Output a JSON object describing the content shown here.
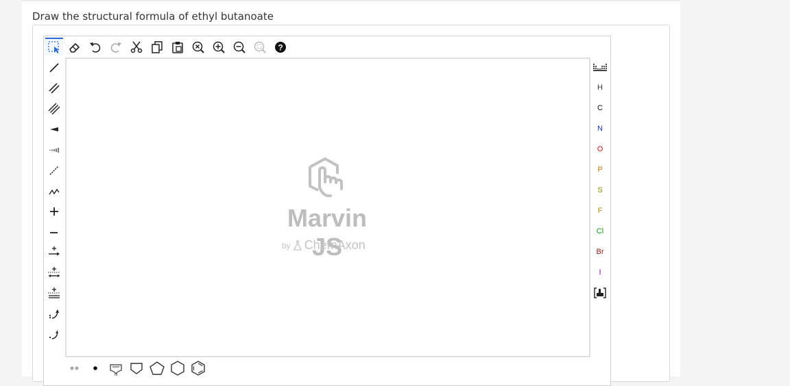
{
  "question": {
    "text": "Draw the structural formula of ethyl butanoate"
  },
  "editor": {
    "logo": {
      "title": "Marvin JS",
      "by": "by",
      "company": "ChemAxon"
    },
    "elements": [
      {
        "symbol": "H",
        "color": "#333333"
      },
      {
        "symbol": "C",
        "color": "#111111"
      },
      {
        "symbol": "N",
        "color": "#2233cc"
      },
      {
        "symbol": "O",
        "color": "#dd1111"
      },
      {
        "symbol": "P",
        "color": "#c77700"
      },
      {
        "symbol": "S",
        "color": "#8a8a00"
      },
      {
        "symbol": "F",
        "color": "#b8860b"
      },
      {
        "symbol": "Cl",
        "color": "#119911"
      },
      {
        "symbol": "Br",
        "color": "#8b1a1a"
      },
      {
        "symbol": "I",
        "color": "#8e00b5"
      }
    ],
    "help_glyph": "?"
  }
}
